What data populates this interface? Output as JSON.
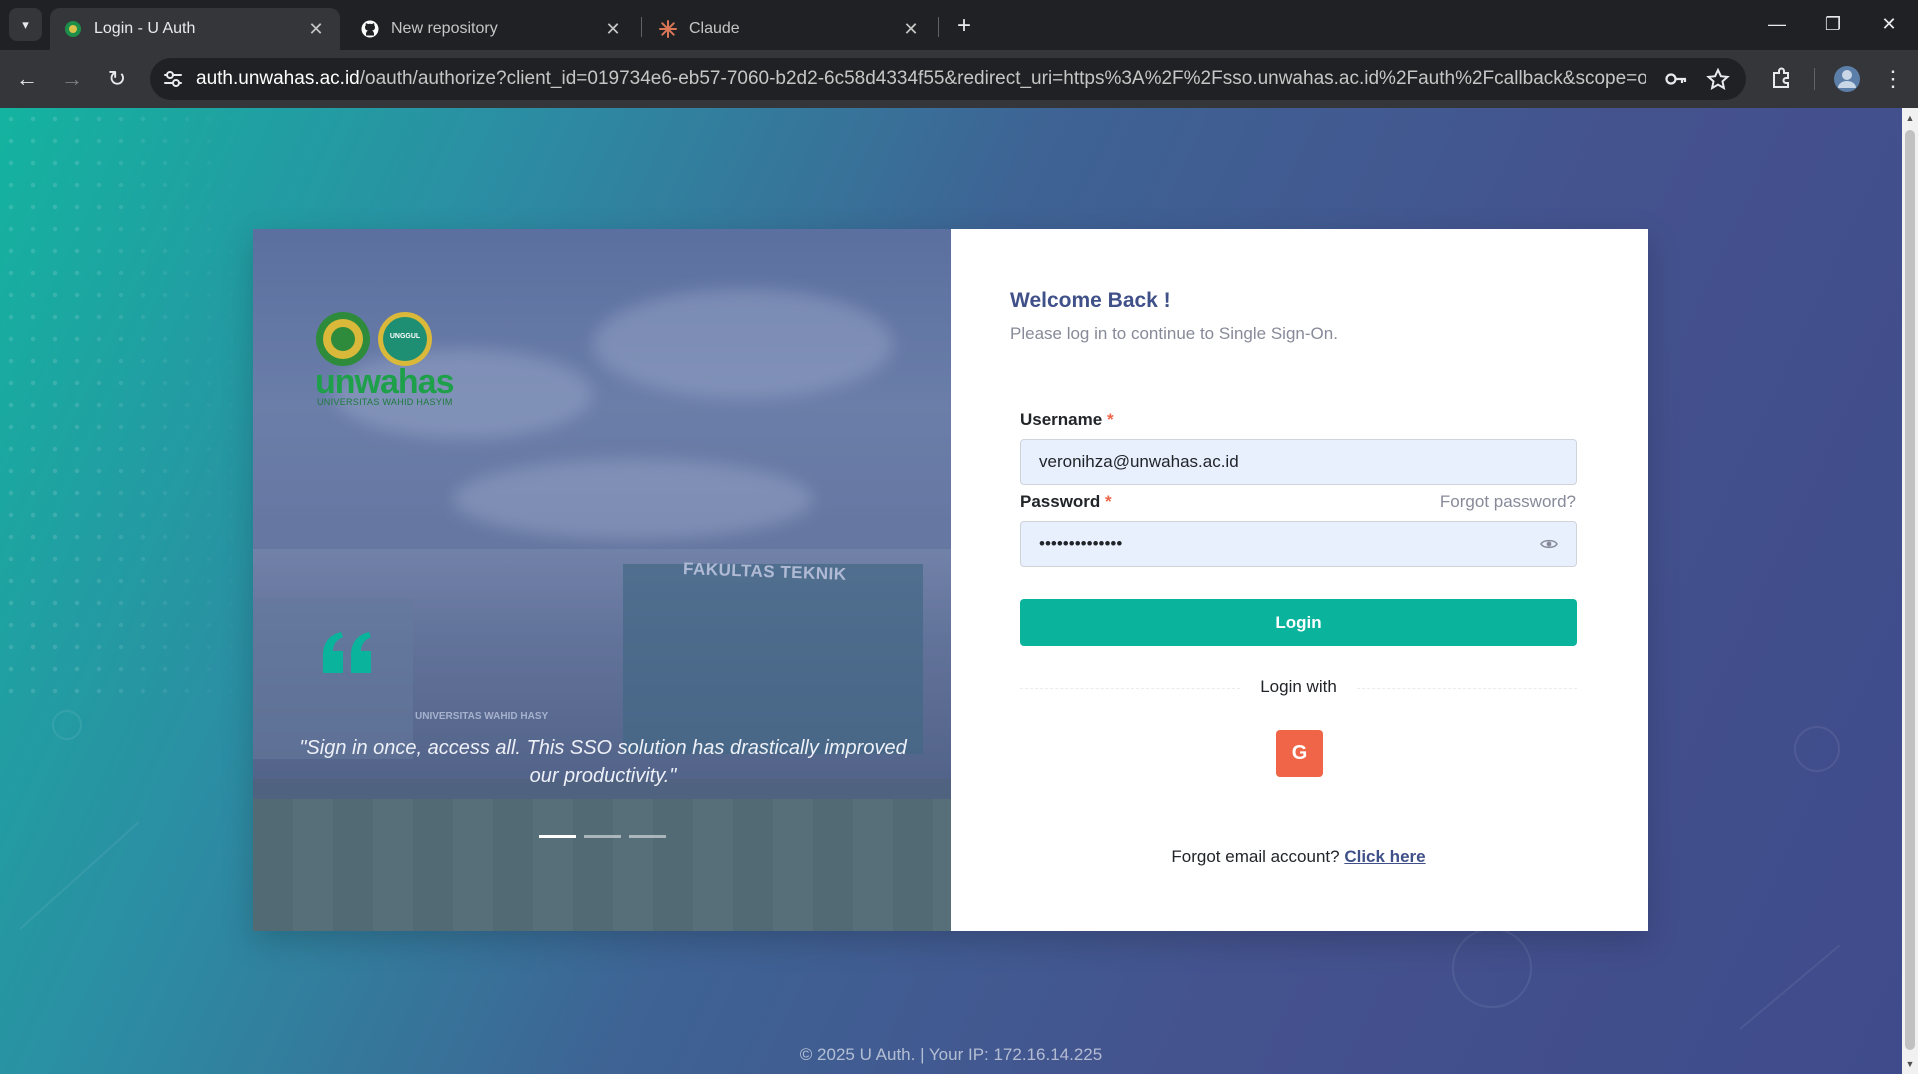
{
  "browser": {
    "tabs": [
      {
        "title": "Login - U Auth",
        "active": true
      },
      {
        "title": "New repository",
        "active": false
      },
      {
        "title": "Claude",
        "active": false
      }
    ],
    "url": {
      "host": "auth.unwahas.ac.id",
      "path": "/oauth/authorize?client_id=019734e6-eb57-7060-b2d2-6c58d4334f55&redirect_uri=https%3A%2F%2Fsso.unwahas.ac.id%2Fauth%2Fcallback&scope=openid+email+pr..."
    }
  },
  "hero": {
    "logo_text": "unwahas",
    "logo_subtext": "UNIVERSITAS WAHID HASYIM",
    "badge_text": "UNGGUL",
    "building_sign": "FAKULTAS TEKNIK",
    "building_label": "UNIVERSITAS WAHID HASY",
    "quote": "\"Sign in once, access all. This SSO solution has drastically improved our productivity.\"",
    "slides_count": 3,
    "active_slide": 1
  },
  "form": {
    "title": "Welcome Back !",
    "subtitle": "Please log in to continue to Single Sign-On.",
    "username_label": "Username",
    "username_value": "veronihza@unwahas.ac.id",
    "password_label": "Password",
    "password_value": "••••••••••••••",
    "required_mark": "*",
    "forgot_password": "Forgot password?",
    "login_button": "Login",
    "login_with": "Login with",
    "google_button": "G",
    "forgot_email_text": "Forgot email account?",
    "forgot_email_link": "Click here"
  },
  "footer": {
    "text": "© 2025 U Auth. | Your IP: 172.16.14.225"
  },
  "colors": {
    "primary": "#405189",
    "success": "#0ab39c",
    "danger": "#f06548"
  }
}
